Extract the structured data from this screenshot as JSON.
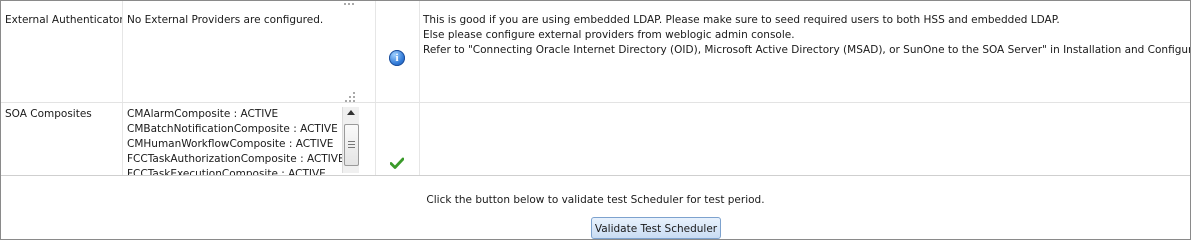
{
  "rows": [
    {
      "name": "External Authenticators",
      "value": "No External Providers are configured.",
      "status_icon": "info-icon",
      "info": [
        "This is good if you are using embedded LDAP. Please make sure to seed required users to both HSS and embedded LDAP.",
        "Else please configure external providers from weblogic admin console.",
        "Refer to \"Connecting Oracle Internet Directory (OID), Microsoft Active Directory (MSAD), or SunOne to the SOA Server\" in Installation and Configuration Guide"
      ]
    },
    {
      "name": "SOA Composites",
      "values": [
        "CMAlarmComposite : ACTIVE",
        "CMBatchNotificationComposite : ACTIVE",
        "CMHumanWorkflowComposite : ACTIVE",
        "FCCTaskAuthorizationComposite : ACTIVE",
        "FCCTaskExecutionComposite : ACTIVE"
      ],
      "status_icon": "check-icon",
      "info": []
    }
  ],
  "footer": {
    "message": "Click the button below to validate test Scheduler for test period.",
    "button_label": "Validate Test Scheduler"
  },
  "colors": {
    "status_ok": "#3a9a2a",
    "info_blue": "#2f78d6",
    "button_border": "#7da2ce"
  }
}
